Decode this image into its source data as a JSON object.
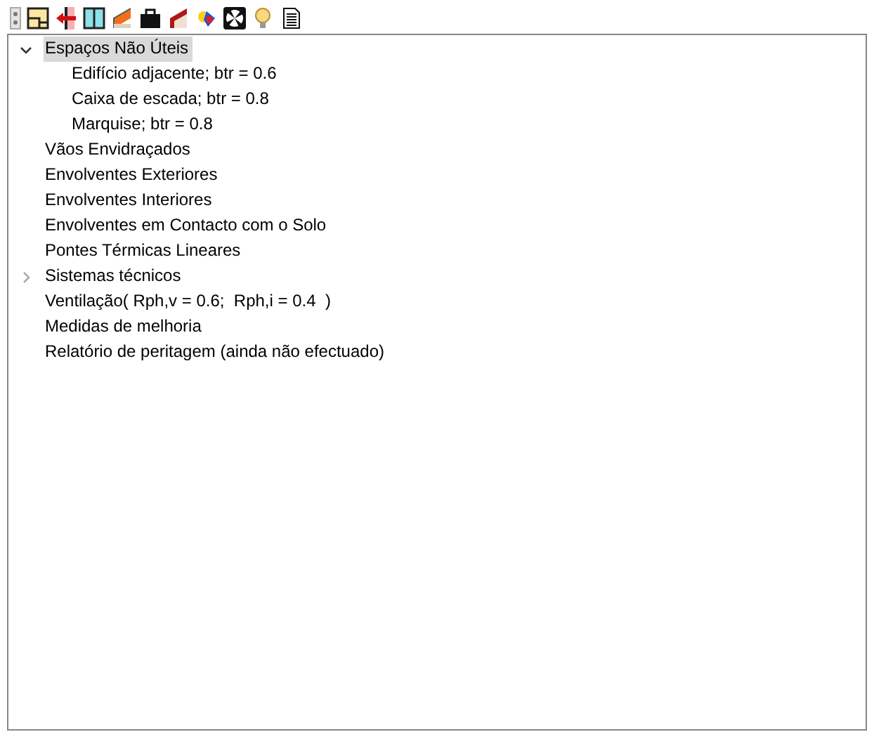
{
  "tree": [
    {
      "label": "Espaços Não Úteis",
      "selected": true,
      "expanded": true,
      "children": [
        {
          "label": "Edifício adjacente; btr = 0.6",
          "selected": false
        },
        {
          "label": "Caixa de escada; btr = 0.8",
          "selected": false
        },
        {
          "label": "Marquise; btr = 0.8",
          "selected": false
        }
      ]
    },
    {
      "label": "Vãos Envidraçados",
      "selected": false
    },
    {
      "label": "Envolventes Exteriores",
      "selected": false
    },
    {
      "label": "Envolventes Interiores",
      "selected": false
    },
    {
      "label": "Envolventes em Contacto com o Solo",
      "selected": false
    },
    {
      "label": "Pontes Térmicas Lineares",
      "selected": false
    },
    {
      "label": "Sistemas técnicos",
      "selected": false,
      "expanded": false
    },
    {
      "label": "Ventilação( Rph,v = 0.6;  Rph,i = 0.4  )",
      "selected": false
    },
    {
      "label": "Medidas de melhoria",
      "selected": false
    },
    {
      "label": "Relatório de peritagem (ainda não efectuado)",
      "selected": false
    }
  ]
}
